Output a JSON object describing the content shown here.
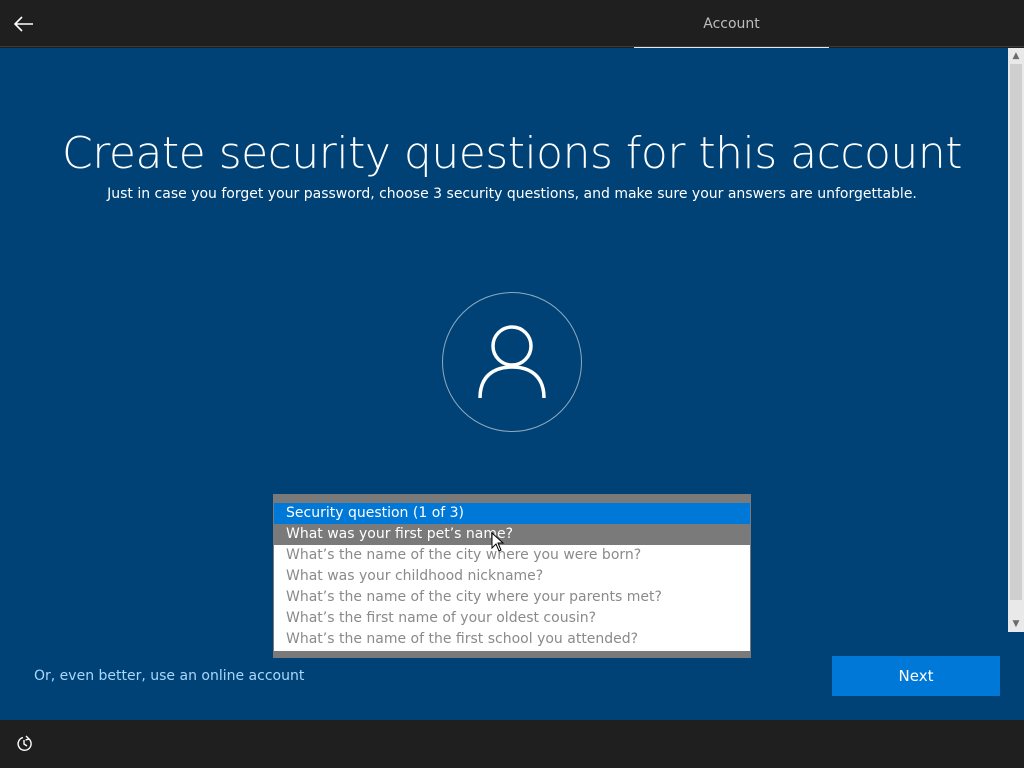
{
  "header": {
    "tab_label": "Account",
    "back_icon": "back-arrow-icon"
  },
  "main": {
    "title": "Create security questions for this account",
    "subtitle": "Just in case you forget your password, choose 3 security questions, and make sure your answers are unforgettable.",
    "avatar_icon": "user-icon"
  },
  "security_dropdown": {
    "options": [
      "Security question (1 of 3)",
      "What was your first pet’s name?",
      "What’s the name of the city where you were born?",
      "What was your childhood nickname?",
      "What’s the name of the city where your parents met?",
      "What’s the first name of your oldest cousin?",
      "What’s the name of the first school you attended?"
    ],
    "selected_index": 0,
    "hovered_index": 1
  },
  "footer": {
    "online_account_link": "Or, even better, use an online account",
    "next_label": "Next",
    "ease_icon": "ease-of-access-icon"
  },
  "colors": {
    "background": "#004275",
    "accent": "#0078d7",
    "chrome": "#1f1f1f",
    "link": "#a8d8ff"
  }
}
